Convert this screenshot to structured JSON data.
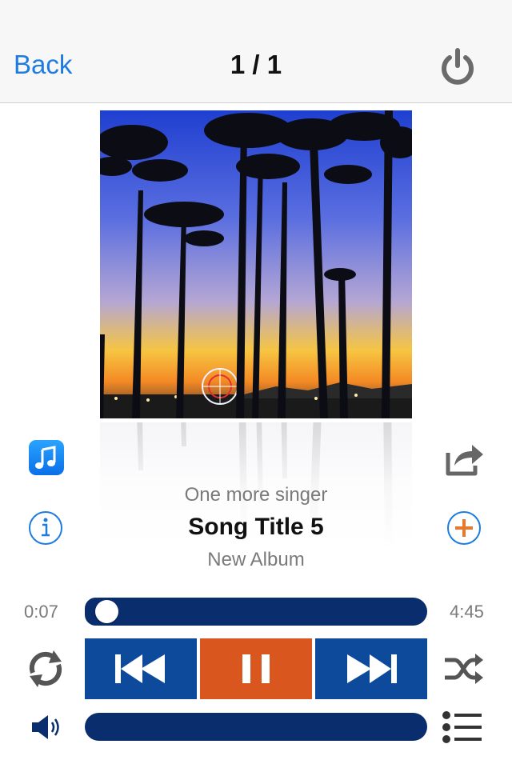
{
  "navbar": {
    "back_label": "Back",
    "title": "1 / 1",
    "power_icon": "power-icon"
  },
  "artwork": {
    "description_icon": "album-artwork"
  },
  "track": {
    "artist": "One more singer",
    "title": "Song Title 5",
    "album": "New Album"
  },
  "progress": {
    "elapsed": "0:07",
    "total": "4:45",
    "fraction": 0.025
  },
  "volume": {
    "fraction": 0.0
  },
  "icons": {
    "music": "music-note-icon",
    "share": "share-icon",
    "info": "info-icon",
    "add": "add-icon",
    "prev": "previous-track-icon",
    "pause": "pause-icon",
    "next": "next-track-icon",
    "repeat": "repeat-icon",
    "shuffle": "shuffle-icon",
    "speaker": "speaker-icon",
    "list": "list-icon"
  },
  "colors": {
    "accent_blue": "#1d7ce0",
    "control_blue": "#0e4a9c",
    "track_navy": "#0a2d6e",
    "pause_orange": "#d9571f",
    "add_orange": "#e8792b"
  }
}
